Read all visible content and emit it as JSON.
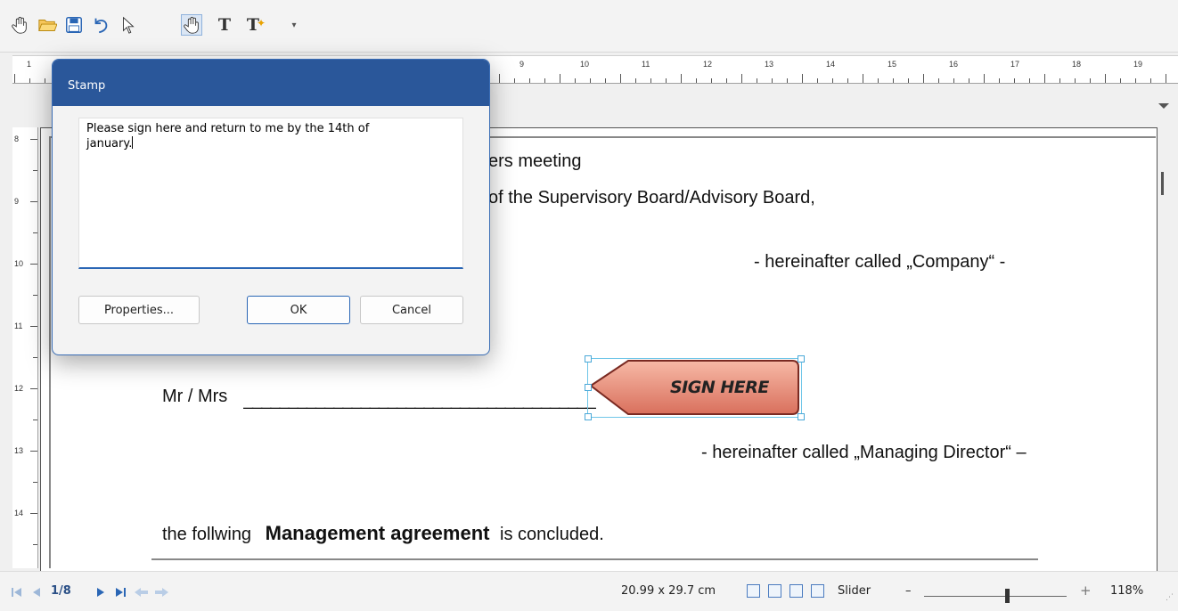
{
  "toolbar": {
    "icons": [
      "hand-icon",
      "open-folder-icon",
      "save-icon",
      "undo-icon",
      "pointer-icon",
      "pan-hand-icon",
      "text-icon",
      "text-add-icon",
      "customize-icon"
    ],
    "text_glyph": "T",
    "text_plus_glyph": "T",
    "customize_glyph": "▾"
  },
  "ruler": {
    "horizontal": [
      "1",
      "9",
      "10",
      "11",
      "12",
      "13",
      "14",
      "15",
      "16",
      "17",
      "18",
      "19"
    ],
    "vertical": [
      "8",
      "9",
      "10",
      "11",
      "12",
      "13",
      "14"
    ]
  },
  "document": {
    "line1": "ers meeting",
    "line2": "of the Supervisory Board/Advisory Board,",
    "line3": "- hereinafter called „Company“ -",
    "line4": "Mr / Mrs",
    "line4_blank": "_______________________________________",
    "line5": "- hereinafter called „Managing Director“ –",
    "line6_pre": "the follwing",
    "line6_bold": "Management agreement",
    "line6_post": "is concluded."
  },
  "stamp": {
    "text": "SIGN HERE"
  },
  "dialog": {
    "title": "Stamp",
    "note_text": "Please sign here and return to me by the 14th of\njanuary.",
    "buttons": {
      "properties": "Properties...",
      "ok": "OK",
      "cancel": "Cancel"
    }
  },
  "statusbar": {
    "page_indicator": "1/8",
    "page_size": "20.99 x 29.7 cm",
    "zoom_mode": "Slider",
    "zoom_minus": "–",
    "zoom_plus": "+",
    "zoom_level": "118%"
  }
}
